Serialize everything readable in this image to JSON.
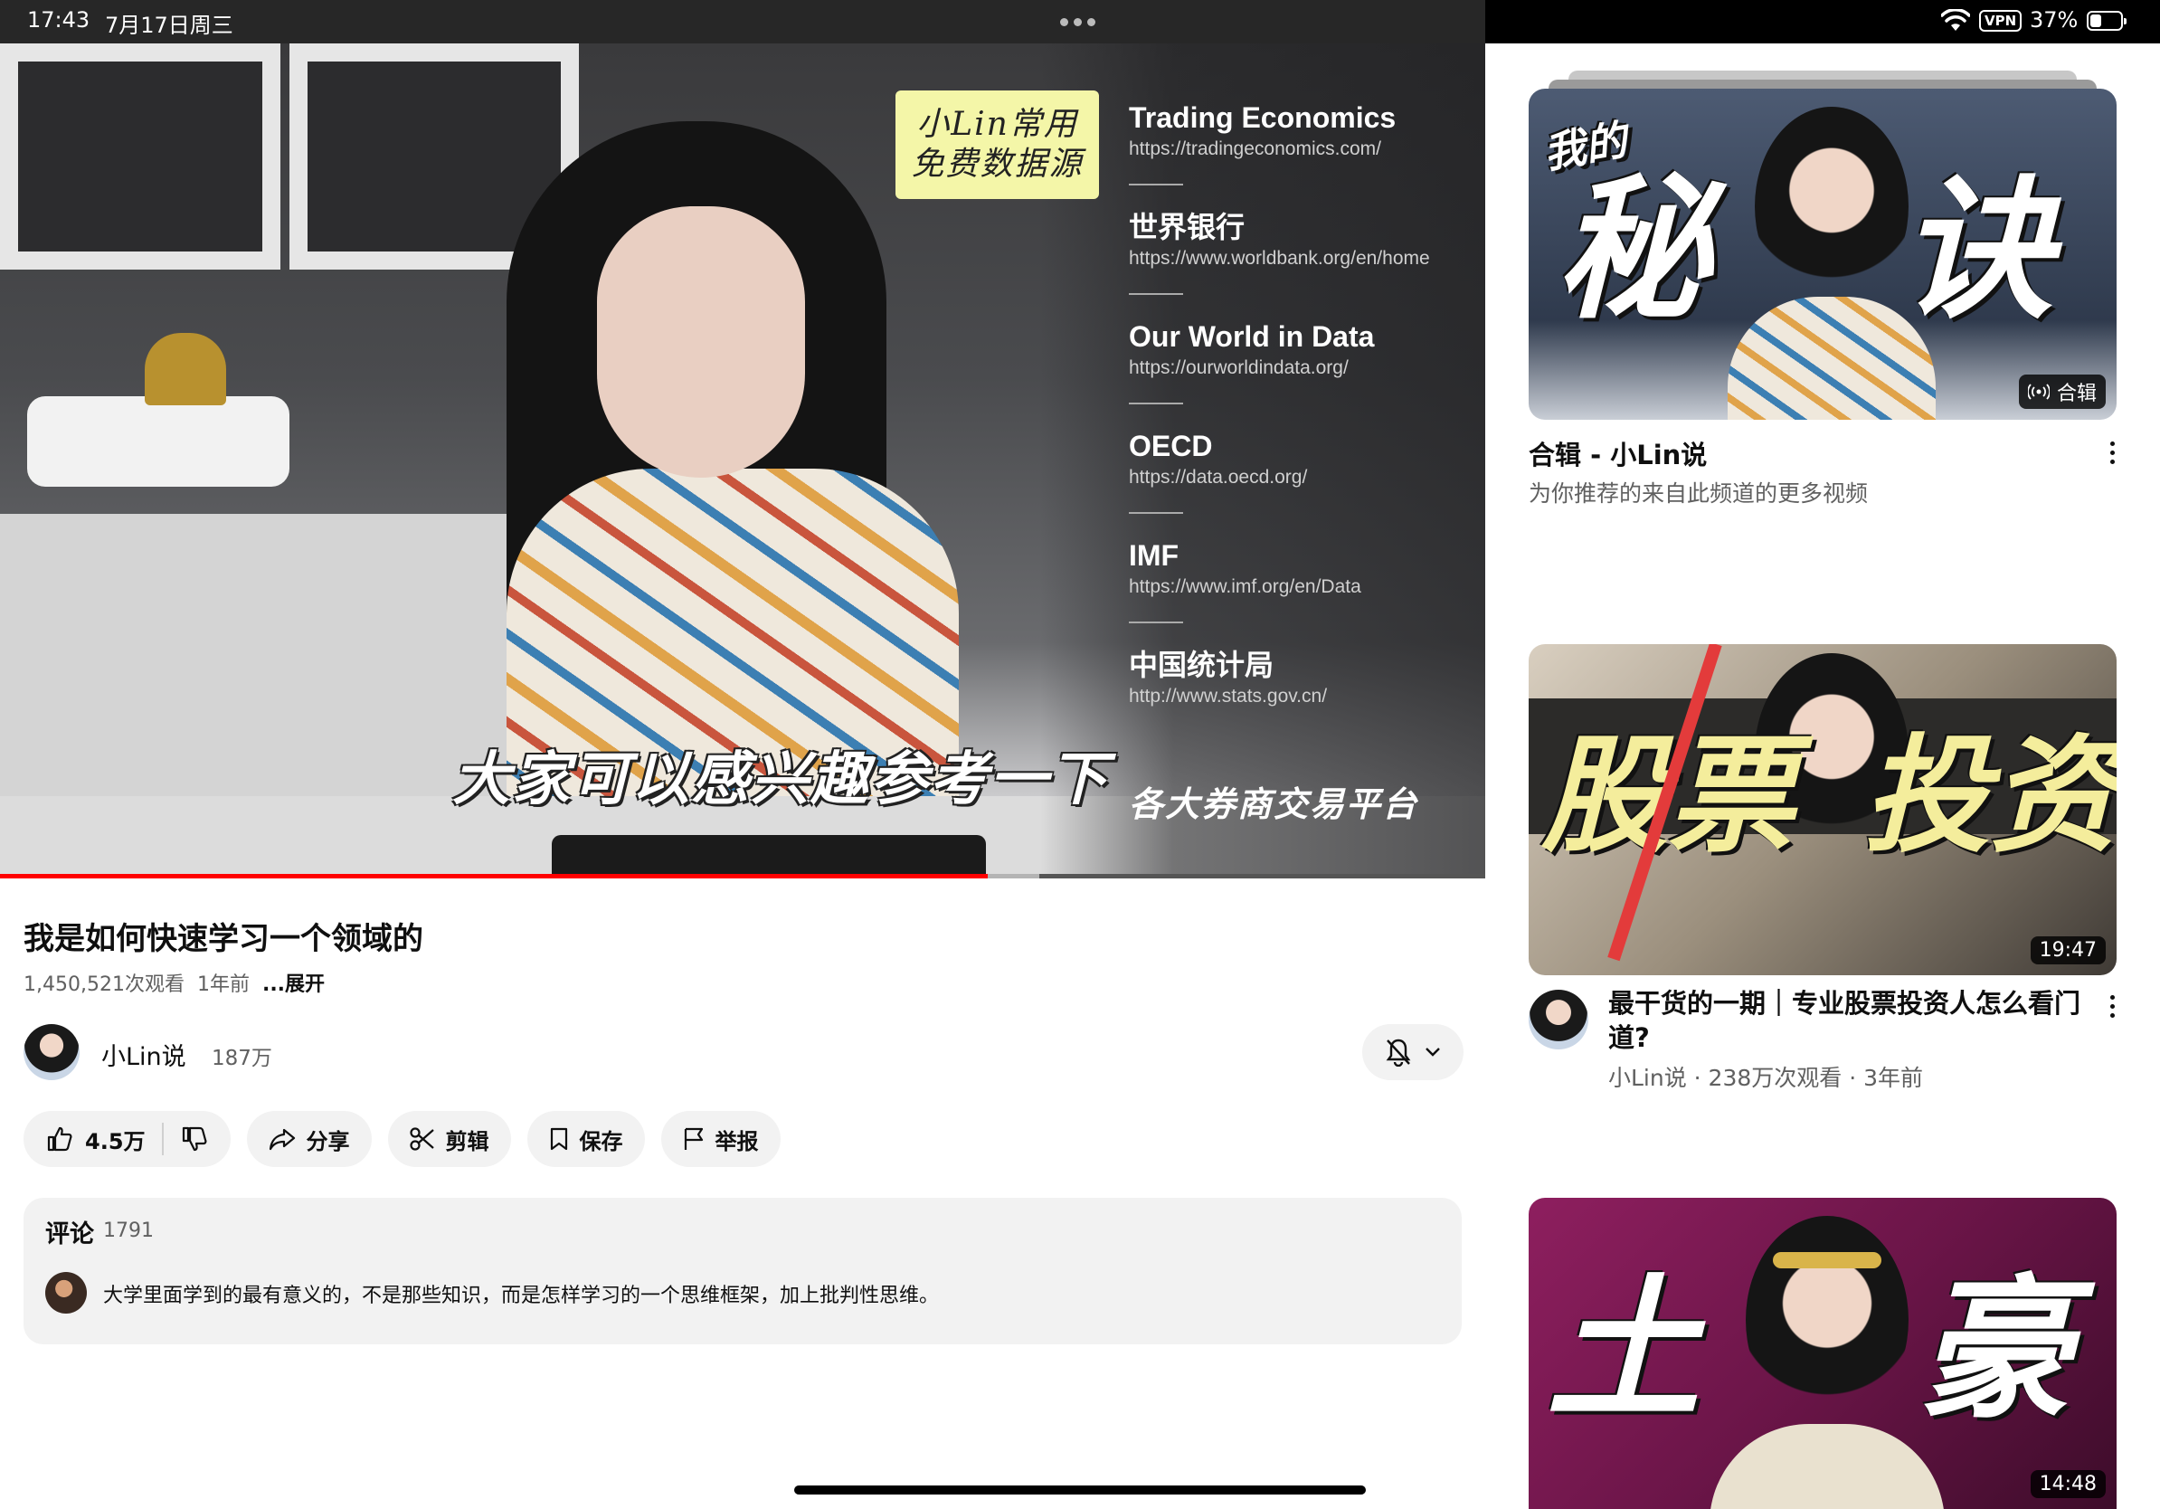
{
  "status_bar": {
    "time": "17:43",
    "date": "7月17日周三",
    "vpn_label": "VPN",
    "battery_percent": "37%",
    "battery_level": 0.37
  },
  "player": {
    "card_line1": "小Lin常用",
    "card_line2": "免费数据源",
    "sources": [
      {
        "name": "Trading Economics",
        "url": "https://tradingeconomics.com/"
      },
      {
        "name": "世界银行",
        "url": "https://www.worldbank.org/en/home"
      },
      {
        "name": "Our World in Data",
        "url": "https://ourworldindata.org/"
      },
      {
        "name": "OECD",
        "url": "https://data.oecd.org/"
      },
      {
        "name": "IMF",
        "url": "https://www.imf.org/en/Data"
      },
      {
        "name": "中国统计局",
        "url": "http://www.stats.gov.cn/"
      }
    ],
    "last_source": "各大券商交易平台",
    "subtitle": "大家可以感兴趣参考一下",
    "progress_played": 0.665,
    "progress_buffered": 0.7
  },
  "video": {
    "title": "我是如何快速学习一个领域的",
    "views": "1,450,521次观看",
    "age": "1年前",
    "expand": "...展开"
  },
  "channel": {
    "name": "小Lin说",
    "subscribers": "187万"
  },
  "actions": {
    "likes": "4.5万",
    "share": "分享",
    "clip": "剪辑",
    "save": "保存",
    "report": "举报"
  },
  "comments": {
    "heading": "评论",
    "count": "1791",
    "top_comment": "大学里面学到的最有意义的，不是那些知识，而是怎样学习的一个思维框架，加上批判性思维。"
  },
  "recommendations": {
    "mix": {
      "thumb_small": "我的",
      "thumb_left": "秘",
      "thumb_right": "诀",
      "badge": "合辑",
      "title": "合辑 - 小Lin说",
      "subtitle": "为你推荐的来自此频道的更多视频"
    },
    "video1": {
      "thumb_left": "股票",
      "thumb_right": "投资",
      "duration": "19:47",
      "title": "最干货的一期｜专业股票投资人怎么看门道?",
      "meta": "小Lin说 · 238万次观看 · 3年前"
    },
    "video2": {
      "thumb_left": "土",
      "thumb_right": "豪",
      "duration": "14:48"
    }
  }
}
